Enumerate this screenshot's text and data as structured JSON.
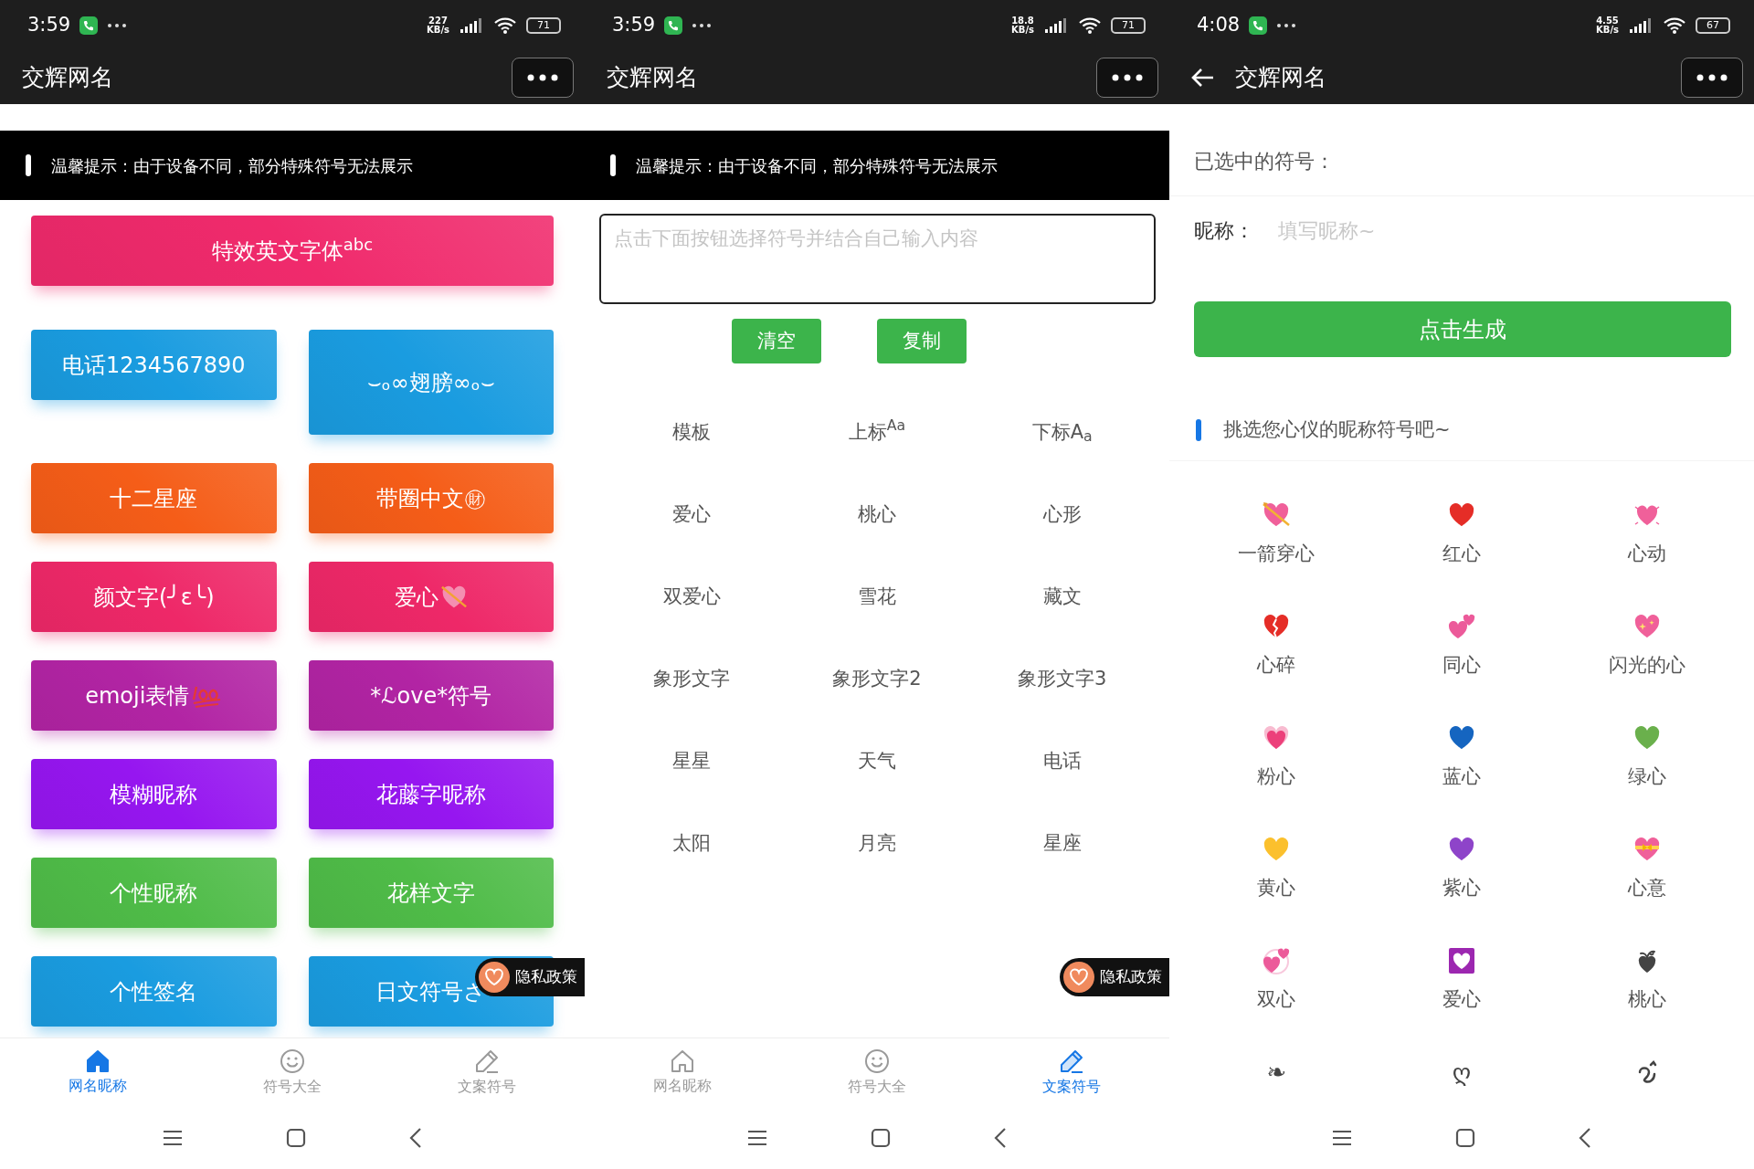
{
  "screens": [
    {
      "kind": "home",
      "status_bar": {
        "time": "3:59",
        "speed": "227",
        "speed_unit": "KB/s",
        "battery": "71"
      },
      "header": {
        "title": "交辉网名",
        "back": false
      },
      "notice": "温馨提示：由于设备不同，部分特殊符号无法展示",
      "feature_buttons": [
        {
          "kind": "text",
          "label": "特效英文字体$^{abc}$",
          "color": "#f02a6c"
        },
        {
          "kind": "text",
          "label": "电话1234567890",
          "color": "#1a9ce0"
        },
        {
          "kind": "text",
          "label": "⌣ₒ∞翅膀∞ₒ⌣",
          "color": "#1a9ce0"
        },
        {
          "kind": "text",
          "label": "十二星座",
          "color": "#f55d18"
        },
        {
          "kind": "text",
          "label": "带圈中文㊖",
          "color": "#f55d18"
        },
        {
          "kind": "text",
          "label": "颜文字(╯ε╰)",
          "color": "#ee2868"
        },
        {
          "kind": "heart",
          "label": "爱心",
          "color": "#ee2868"
        },
        {
          "kind": "score",
          "label": "emoji表情",
          "color": "#b224a4"
        },
        {
          "kind": "text",
          "label": "*ℒove*符号",
          "color": "#b224a4"
        },
        {
          "kind": "text",
          "label": "模糊昵称",
          "color": "#9616f0"
        },
        {
          "kind": "text",
          "label": "花藤字昵称",
          "color": "#9616f0"
        },
        {
          "kind": "text",
          "label": "个性昵称",
          "color": "#4fbc48"
        },
        {
          "kind": "text",
          "label": "花样文字",
          "color": "#4fbc48"
        },
        {
          "kind": "text",
          "label": "个性签名",
          "color": "#1a9ce0"
        },
        {
          "kind": "text",
          "label": "日文符号さ",
          "color": "#1a9ce0"
        }
      ],
      "privacy_badge": "隐私政策",
      "tabs": [
        {
          "label": "网名昵称",
          "selected": true
        },
        {
          "label": "符号大全",
          "selected": false
        },
        {
          "label": "文案符号",
          "selected": false
        }
      ]
    },
    {
      "kind": "symbols",
      "status_bar": {
        "time": "3:59",
        "speed": "18.8",
        "speed_unit": "KB/s",
        "battery": "71"
      },
      "header": {
        "title": "交辉网名",
        "back": false
      },
      "notice": "温馨提示：由于设备不同，部分特殊符号无法展示",
      "editor": {
        "placeholder": "点击下面按钮选择符号并结合自己输入内容"
      },
      "actions": [
        "清空",
        "复制"
      ],
      "categories": [
        "模板",
        "上标$^{Aa}$",
        "下标A$_{a}$",
        "爱心",
        "桃心",
        "心形",
        "双爱心",
        "雪花",
        "藏文",
        "象形文字",
        "象形文字2",
        "象形文字3",
        "星星",
        "天气",
        "电话",
        "太阳",
        "月亮",
        "星座"
      ],
      "privacy_badge": "隐私政策",
      "tabs": [
        {
          "label": "网名昵称",
          "selected": false
        },
        {
          "label": "符号大全",
          "selected": false
        },
        {
          "label": "文案符号",
          "selected": true
        }
      ]
    },
    {
      "kind": "generator",
      "status_bar": {
        "time": "4:08",
        "speed": "4.55",
        "speed_unit": "KB/s",
        "battery": "67"
      },
      "header": {
        "title": "交辉网名",
        "back": true
      },
      "selected_label": "已选中的符号：",
      "nickname": {
        "label": "昵称：",
        "placeholder": "填写昵称~"
      },
      "generate_button": "点击生成",
      "section_title": "挑选您心仪的昵称符号吧~",
      "symbols": [
        {
          "kind": "arrow",
          "color": "#f0609a",
          "label": "一箭穿心"
        },
        {
          "kind": "plain",
          "color": "#e52d27",
          "label": "红心"
        },
        {
          "kind": "beating",
          "color": "#f0609a",
          "label": "心动"
        },
        {
          "kind": "broken",
          "color": "#e52d27",
          "label": "心碎"
        },
        {
          "kind": "two",
          "color": "#ec5a9a",
          "label": "同心"
        },
        {
          "kind": "sparkle",
          "color": "#f0609a",
          "label": "闪光的心"
        },
        {
          "kind": "growing",
          "color": "#ec407a",
          "label": "粉心"
        },
        {
          "kind": "plain",
          "color": "#1565c0",
          "label": "蓝心"
        },
        {
          "kind": "plain",
          "color": "#6ab04c",
          "label": "绿心"
        },
        {
          "kind": "plain",
          "color": "#fbc02d",
          "label": "黄心"
        },
        {
          "kind": "plain",
          "color": "#8e44c9",
          "label": "紫心"
        },
        {
          "kind": "ribbon",
          "color": "#f0609a",
          "label": "心意"
        },
        {
          "kind": "revolving",
          "color": "#ec5a9a",
          "label": "双心"
        },
        {
          "kind": "boxed",
          "color": "#9c27b0",
          "label": "爱心"
        },
        {
          "kind": "floral",
          "color": "#444444",
          "label": "桃心"
        },
        {
          "kind": "glyph",
          "color": "#444444",
          "symbol": "❧"
        },
        {
          "kind": "glyph",
          "color": "#444444",
          "symbol": "ღ"
        },
        {
          "kind": "squiggle",
          "color": "#444444"
        }
      ]
    }
  ]
}
